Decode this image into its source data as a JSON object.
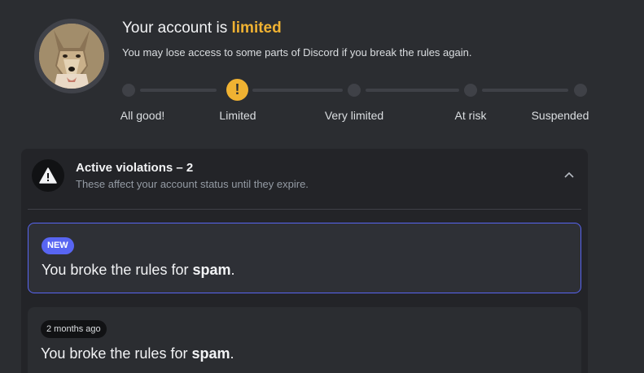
{
  "status": {
    "title_prefix": "Your account is ",
    "title_level": "limited",
    "subtitle": "You may lose access to some parts of Discord if you break the rules again.",
    "accent_color": "#f0b232",
    "active_icon": "!"
  },
  "steps": [
    {
      "label": "All good!",
      "active": false
    },
    {
      "label": "Limited",
      "active": true
    },
    {
      "label": "Very limited",
      "active": false
    },
    {
      "label": "At risk",
      "active": false
    },
    {
      "label": "Suspended",
      "active": false
    }
  ],
  "violations": {
    "title": "Active violations – 2",
    "subtitle": "These affect your account status until they expire.",
    "icons": {
      "header": "warning-triangle-icon",
      "toggle": "chevron-up-icon"
    },
    "items": [
      {
        "badge": "NEW",
        "text_prefix": "You broke the rules for ",
        "rule": "spam",
        "text_suffix": ".",
        "highlight_color": "#5865f2"
      },
      {
        "badge": "2 months ago",
        "text_prefix": "You broke the rules for ",
        "rule": "spam",
        "text_suffix": "."
      }
    ]
  }
}
